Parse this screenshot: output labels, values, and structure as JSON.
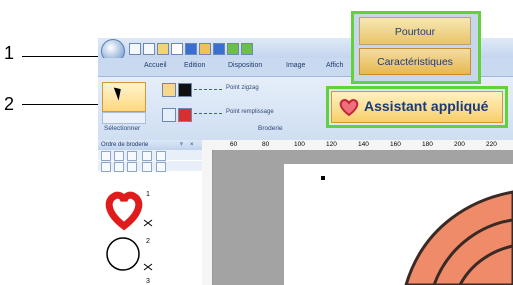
{
  "callouts": [
    {
      "number": "1"
    },
    {
      "number": "2"
    }
  ],
  "app": {
    "tabs": [
      "Accueil",
      "Edition",
      "Disposition",
      "Image",
      "Affich"
    ],
    "ribbon": {
      "stitch_row1_label": "Point zigzag",
      "stitch_row2_label": "Point remplissage",
      "group_selection": "Sélectionner",
      "group_broderie": "Broderie"
    },
    "panel": {
      "title": "Ordre de broderie",
      "pin": "ᵠ",
      "close": "×",
      "items": [
        {
          "order": "1"
        },
        {
          "order": "2"
        },
        {
          "order": "3"
        }
      ]
    },
    "ruler_ticks": [
      "60",
      "80",
      "100",
      "120",
      "140",
      "160",
      "180",
      "200",
      "220"
    ]
  },
  "popups": {
    "tab_pourtour": "Pourtour",
    "tab_caracteristiques": "Caractéristiques",
    "assistant_label": "Assistant appliqué"
  },
  "colors": {
    "highlight": "#62d23a",
    "applique_fill": "#f08b6a",
    "applique_stitch": "#3a2a25",
    "heart_red": "#e01b1b"
  }
}
